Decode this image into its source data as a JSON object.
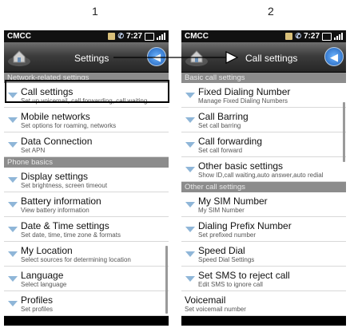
{
  "steps": [
    "1",
    "2"
  ],
  "left": {
    "status": {
      "carrier": "CMCC",
      "time": "7:27"
    },
    "title": "Settings",
    "sections": [
      {
        "header": "Network-related settings",
        "items": [
          {
            "title": "Call settings",
            "subtitle": "Set up voicemail, call forwarding, call waiting"
          },
          {
            "title": "Mobile networks",
            "subtitle": "Set options for roaming, networks"
          },
          {
            "title": "Data Connection",
            "subtitle": "Set APN"
          }
        ]
      },
      {
        "header": "Phone basics",
        "items": [
          {
            "title": "Display settings",
            "subtitle": "Set brightness, screen timeout"
          },
          {
            "title": "Battery information",
            "subtitle": "View battery information"
          },
          {
            "title": "Date & Time settings",
            "subtitle": "Set date, time, time zone & formats"
          },
          {
            "title": "My Location",
            "subtitle": "Select sources for determining location"
          },
          {
            "title": "Language",
            "subtitle": "Select language"
          },
          {
            "title": "Profiles",
            "subtitle": "Set profiles"
          }
        ]
      }
    ]
  },
  "right": {
    "status": {
      "carrier": "CMCC",
      "time": "7:27"
    },
    "title": "Call settings",
    "sections": [
      {
        "header": "Basic call settings",
        "items": [
          {
            "title": "Fixed Dialing Number",
            "subtitle": "Manage Fixed Dialing Numbers"
          },
          {
            "title": "Call Barring",
            "subtitle": "Set call barring"
          },
          {
            "title": "Call forwarding",
            "subtitle": "Set call forward"
          },
          {
            "title": "Other basic settings",
            "subtitle": "Show ID,call waiting,auto answer,auto redial"
          }
        ]
      },
      {
        "header": "Other call settings",
        "items": [
          {
            "title": "My SIM Number",
            "subtitle": "My SIM Number"
          },
          {
            "title": "Dialing Prefix Number",
            "subtitle": "Set prefixed number"
          },
          {
            "title": "Speed Dial",
            "subtitle": "Speed Dial Settings"
          },
          {
            "title": "Set SMS to reject call",
            "subtitle": "Edit SMS to ignore call"
          },
          {
            "title": "Voicemail",
            "subtitle": "Set voicemail number",
            "noarrow": true
          }
        ]
      }
    ]
  },
  "colors": {
    "section_header_bg": "#8c8c8c",
    "arrow_color": "#8fb6d8",
    "back_button": "#1d5fb8"
  },
  "icons": {
    "home": "home-icon",
    "back": "back-arrow-icon",
    "expand": "chevron-down-icon"
  }
}
